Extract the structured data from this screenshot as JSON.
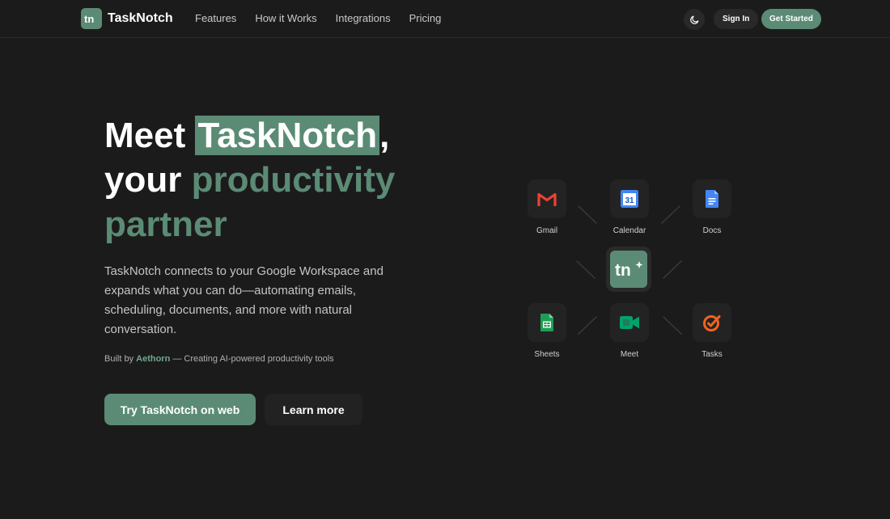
{
  "nav": {
    "brand": "TaskNotch",
    "logo_mark": "tn",
    "links": [
      "Features",
      "How it Works",
      "Integrations",
      "Pricing"
    ],
    "theme_icon": "moon-icon",
    "sign_in": "Sign In",
    "get_started": "Get Started"
  },
  "hero": {
    "headline_part1": "Meet ",
    "headline_highlight": "TaskNotch",
    "headline_comma": ",",
    "headline_line2": "your ",
    "headline_accent": "productivity partner",
    "description": "TaskNotch connects to your Google Workspace and expands what you can do—automating emails, scheduling, documents, and more with natural conversation.",
    "built_by_prefix": "Built by ",
    "built_by_brand": "Aethorn",
    "built_by_suffix": " — Creating AI-powered productivity tools",
    "primary_cta": "Try TaskNotch on web",
    "secondary_cta": "Learn more"
  },
  "integrations": {
    "center_icon": "tasknotch-logo-icon",
    "apps": [
      {
        "label": "Gmail",
        "icon": "gmail-icon"
      },
      {
        "label": "Calendar",
        "icon": "calendar-icon",
        "icon_text": "31"
      },
      {
        "label": "Docs",
        "icon": "docs-icon"
      },
      {
        "label": "Sheets",
        "icon": "sheets-icon"
      },
      {
        "label": "Meet",
        "icon": "meet-icon"
      },
      {
        "label": "Tasks",
        "icon": "tasks-icon"
      }
    ]
  },
  "colors": {
    "background": "#1c1b1c",
    "accent": "#5b8b75",
    "accent_text": "#6fa78d",
    "surface": "#242324",
    "gmail_red": "#ea4335",
    "google_blue": "#4285f4",
    "sheets_green": "#1e9e55",
    "meet_green": "#00a36c",
    "tasks_orange": "#f0641e"
  }
}
